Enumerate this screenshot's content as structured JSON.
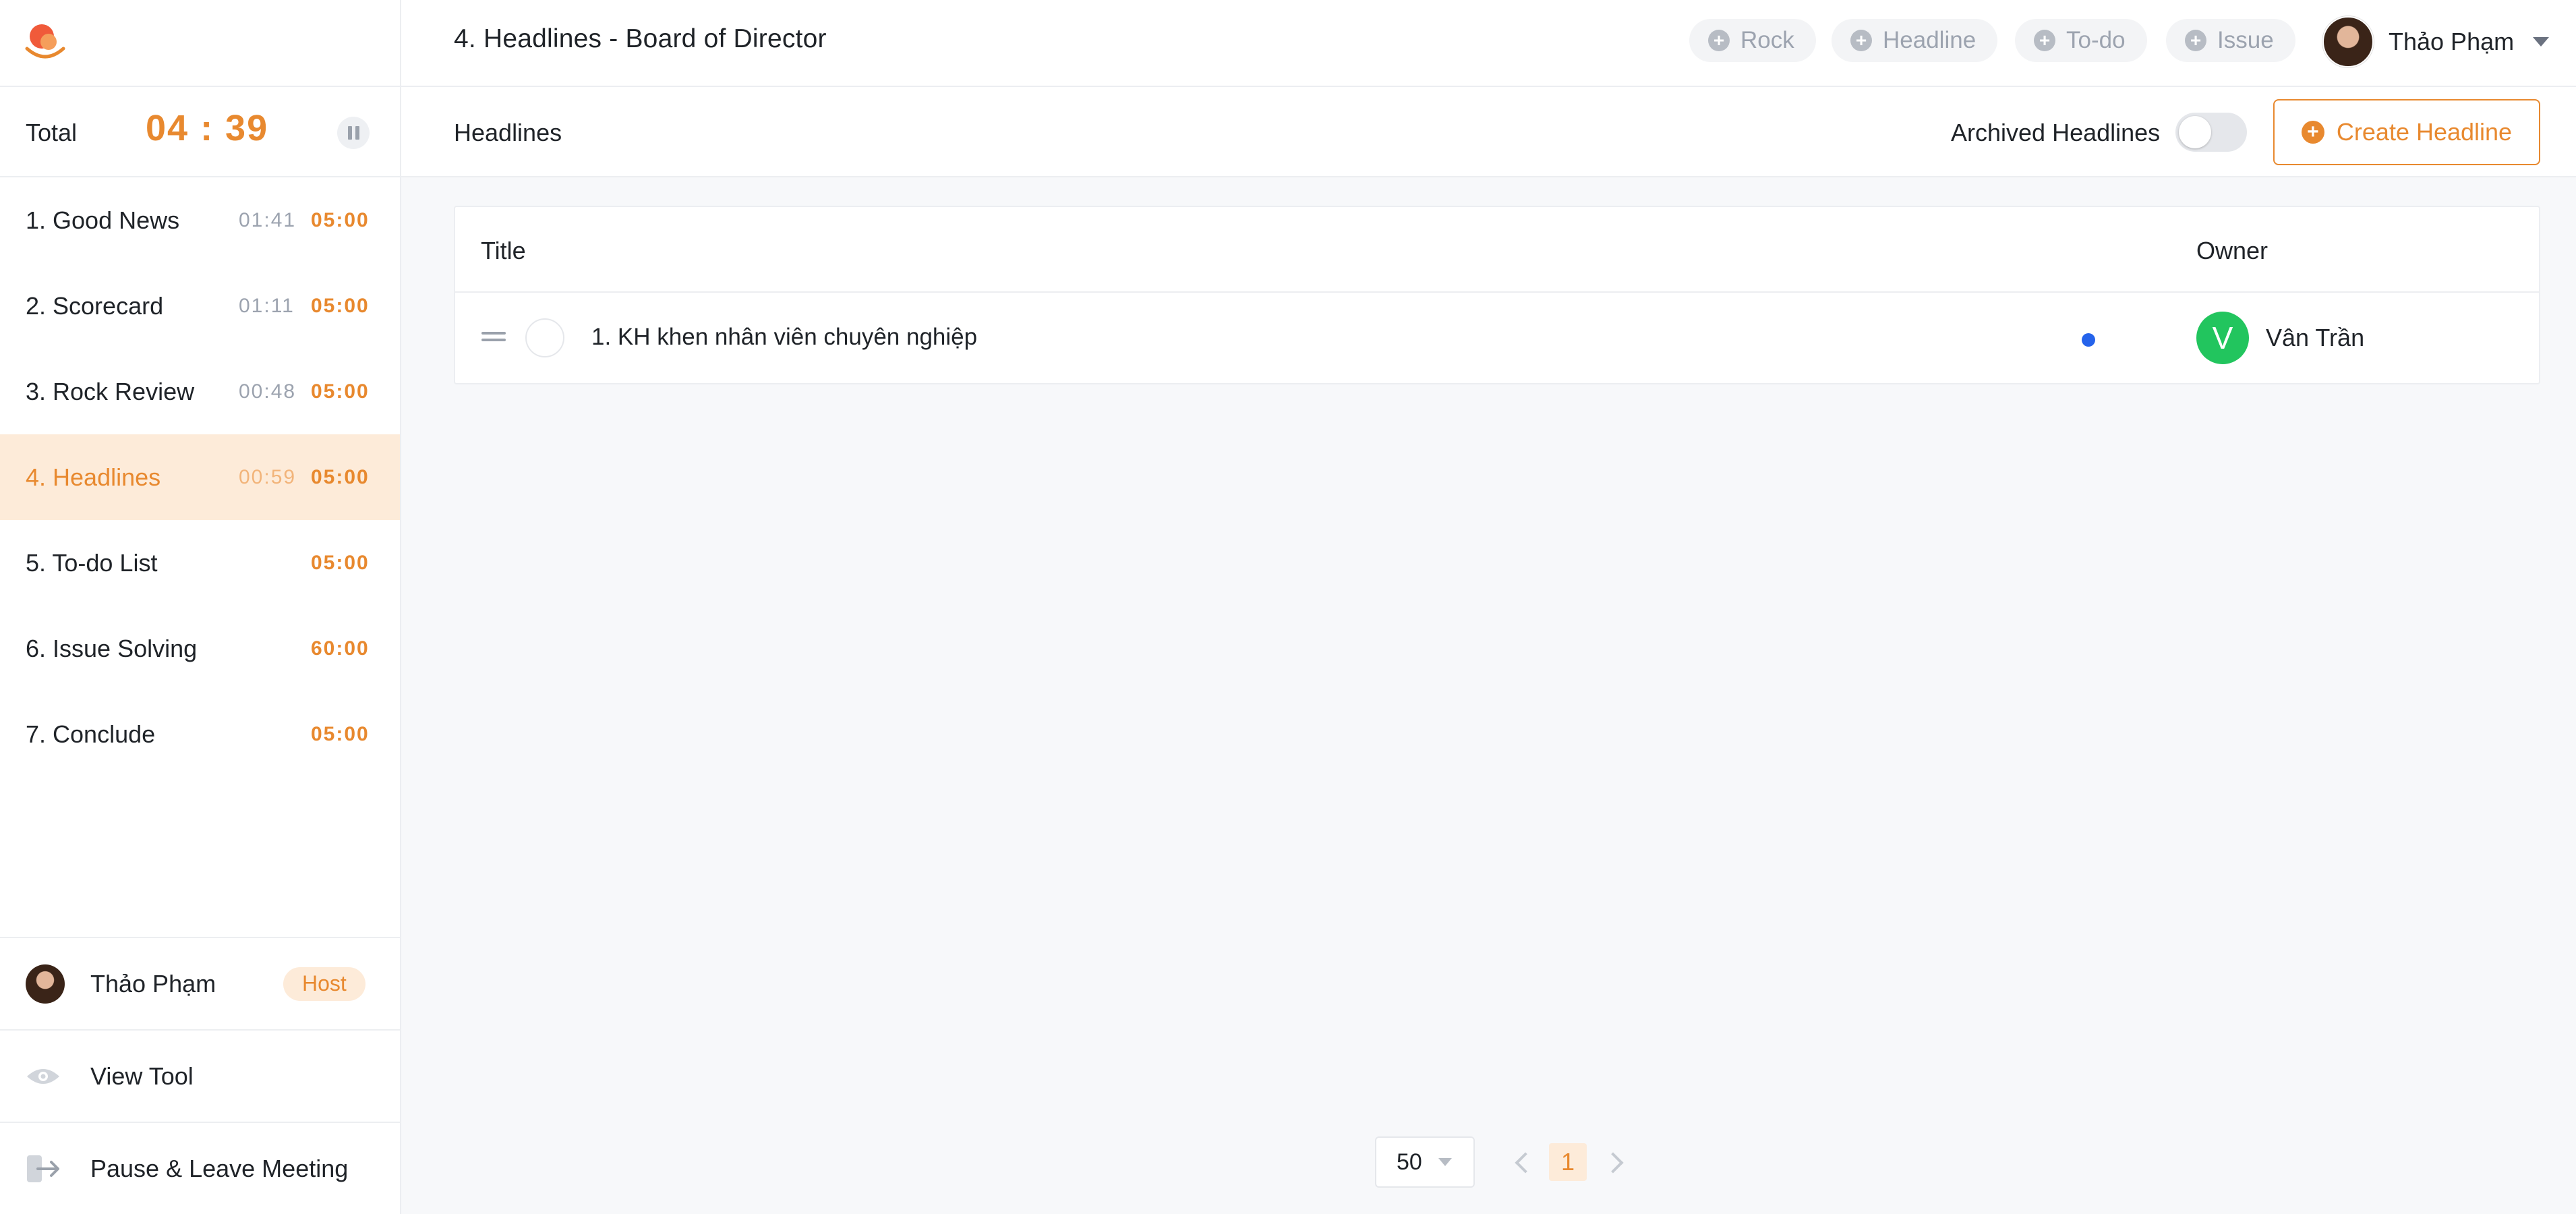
{
  "header": {
    "meeting_title": "4. Headlines - Board of Director",
    "quick_add": [
      "Rock",
      "Headline",
      "To-do",
      "Issue"
    ],
    "user_name": "Thảo Phạm"
  },
  "sidebar": {
    "total_label": "Total",
    "total_time": "04 : 39",
    "agenda": [
      {
        "label": "1.  Good News",
        "elapsed": "01:41",
        "limit": "05:00"
      },
      {
        "label": "2.  Scorecard",
        "elapsed": "01:11",
        "limit": "05:00"
      },
      {
        "label": "3.  Rock Review",
        "elapsed": "00:48",
        "limit": "05:00"
      },
      {
        "label": "4.  Headlines",
        "elapsed": "00:59",
        "limit": "05:00"
      },
      {
        "label": "5.  To-do List",
        "elapsed": "",
        "limit": "05:00"
      },
      {
        "label": "6.  Issue Solving",
        "elapsed": "",
        "limit": "60:00"
      },
      {
        "label": "7.  Conclude",
        "elapsed": "",
        "limit": "05:00"
      }
    ],
    "active_index": 3,
    "host_name": "Thảo Phạm",
    "host_badge": "Host",
    "view_tool": "View Tool",
    "pause_leave": "Pause & Leave Meeting"
  },
  "main": {
    "section_title": "Headlines",
    "archived_label": "Archived Headlines",
    "archived_enabled": false,
    "create_label": "Create Headline",
    "table": {
      "columns": [
        "Title",
        "Owner"
      ],
      "rows": [
        {
          "title": "1. KH khen nhân viên chuyên nghiệp",
          "owner_initial": "V",
          "owner_name": "Vân Trần"
        }
      ]
    },
    "pagination": {
      "page_size": "50",
      "current_page": "1"
    }
  },
  "colors": {
    "accent": "#e8892f",
    "accent_light": "#fdebd9",
    "owner_avatar": "#22c55e",
    "status_dot": "#2563eb"
  }
}
